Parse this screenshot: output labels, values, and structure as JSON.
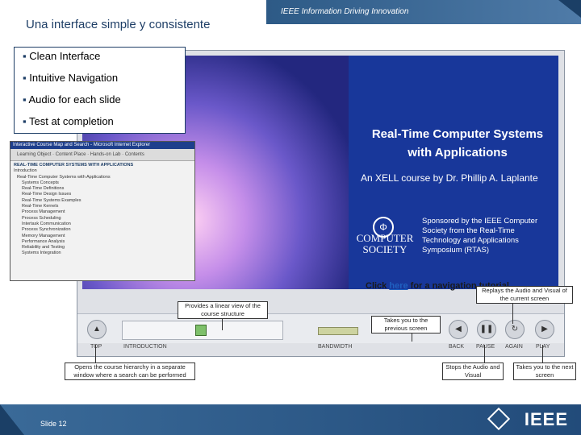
{
  "header": {
    "page_title": "Una interface simple y consistente",
    "tagline": "IEEE Information Driving Innovation"
  },
  "bullets": [
    "Clean Interface",
    "Intuitive Navigation",
    "Audio for each slide",
    "Test at completion"
  ],
  "slide": {
    "course_title_line1": "Real-Time Computer Systems",
    "course_title_line2": "with Applications",
    "course_subtitle": "An XELL course by Dr. Phillip A. Laplante",
    "society_line1": "COMPUTER",
    "society_line2": "SOCIETY",
    "sponsor_text": "Sponsored by the IEEE Computer Society from the Real-Time Technology and Applications Symposium (RTAS)",
    "click_prefix": "Click",
    "click_link": "here",
    "click_suffix": "for a navigation tutorial"
  },
  "control_labels": {
    "top": "TOP",
    "track": "INTRODUCTION",
    "bandwidth": "BANDWIDTH",
    "back": "BACK",
    "pause": "PAUSE",
    "again": "AGAIN",
    "play": "PLAY"
  },
  "callouts": {
    "linear_view": "Provides a linear view of the course structure",
    "replay": "Replays the Audio and Visual of the current screen",
    "previous": "Takes you to the previous screen",
    "hierarchy": "Opens the course hierarchy in a separate window where a search can be performed",
    "stops": "Stops the Audio and Visual",
    "next": "Takes you to the next screen"
  },
  "screenshot": {
    "window_title": "Interactive Course Map and Search - Microsoft Internet Explorer",
    "toolbar_items": [
      "Learning Object",
      "Content Place",
      "Hands-on Lab",
      "Contents"
    ],
    "heading": "REAL-TIME COMPUTER SYSTEMS WITH APPLICATIONS",
    "tree": [
      "Introduction",
      "Real-Time Computer Systems with Applications",
      "Systems Concepts",
      "Real-Time Definitions",
      "Real-Time Design Issues",
      "Real-Time Systems Examples",
      "Real-Time Kernels",
      "Process Management",
      "Process Scheduling",
      "Intertask Communication",
      "Process Synchronization",
      "Memory Management",
      "Performance Analysis",
      "Reliability and Testing",
      "Systems Integration"
    ]
  },
  "footer": {
    "slide_number": "Slide 12",
    "logo_text": "IEEE"
  },
  "colors": {
    "brand": "#1e3e66",
    "slide_blue": "#18379a",
    "footer": "#2d5a86"
  }
}
